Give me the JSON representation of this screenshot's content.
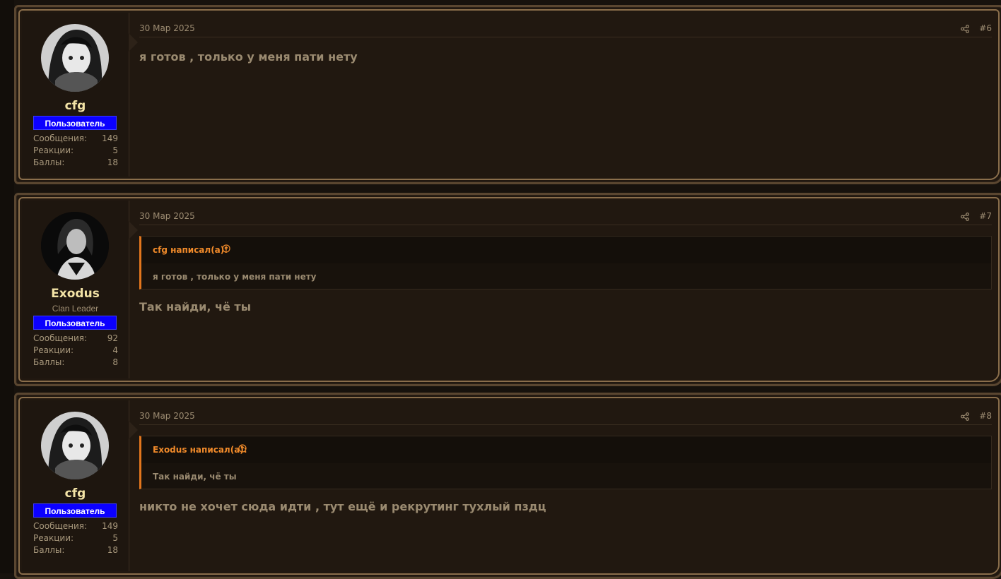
{
  "posts": [
    {
      "username": "cfg",
      "title": "",
      "banner": "Пользователь",
      "stats": [
        {
          "label": "Сообщения:",
          "value": "149"
        },
        {
          "label": "Реакции:",
          "value": "5"
        },
        {
          "label": "Баллы:",
          "value": "18"
        }
      ],
      "date": "30 Мар 2025",
      "number": "#6",
      "message": "я готов , только у меня пати нету"
    },
    {
      "username": "Exodus",
      "title": "Clan Leader",
      "banner": "Пользователь",
      "stats": [
        {
          "label": "Сообщения:",
          "value": "92"
        },
        {
          "label": "Реакции:",
          "value": "4"
        },
        {
          "label": "Баллы:",
          "value": "8"
        }
      ],
      "date": "30 Мар 2025",
      "number": "#7",
      "quote_author": "cfg написал(а):",
      "quote_text": "я готов , только у меня пати нету",
      "message": "Так найди, чё ты"
    },
    {
      "username": "cfg",
      "title": "",
      "banner": "Пользователь",
      "stats": [
        {
          "label": "Сообщения:",
          "value": "149"
        },
        {
          "label": "Реакции:",
          "value": "5"
        },
        {
          "label": "Баллы:",
          "value": "18"
        }
      ],
      "date": "30 Мар 2025",
      "number": "#8",
      "quote_author": "Exodus написал(а):",
      "quote_text": "Так найди, чё ты",
      "message": "никто не хочет сюда идти , тут ещё и рекрутинг тухлый пздц"
    }
  ],
  "colors": {
    "banner": "#0b00ff",
    "username": "#f3e3a6",
    "quote_accent": "#e2761d"
  },
  "icons": [
    "share-icon",
    "quote-jump-icon"
  ]
}
